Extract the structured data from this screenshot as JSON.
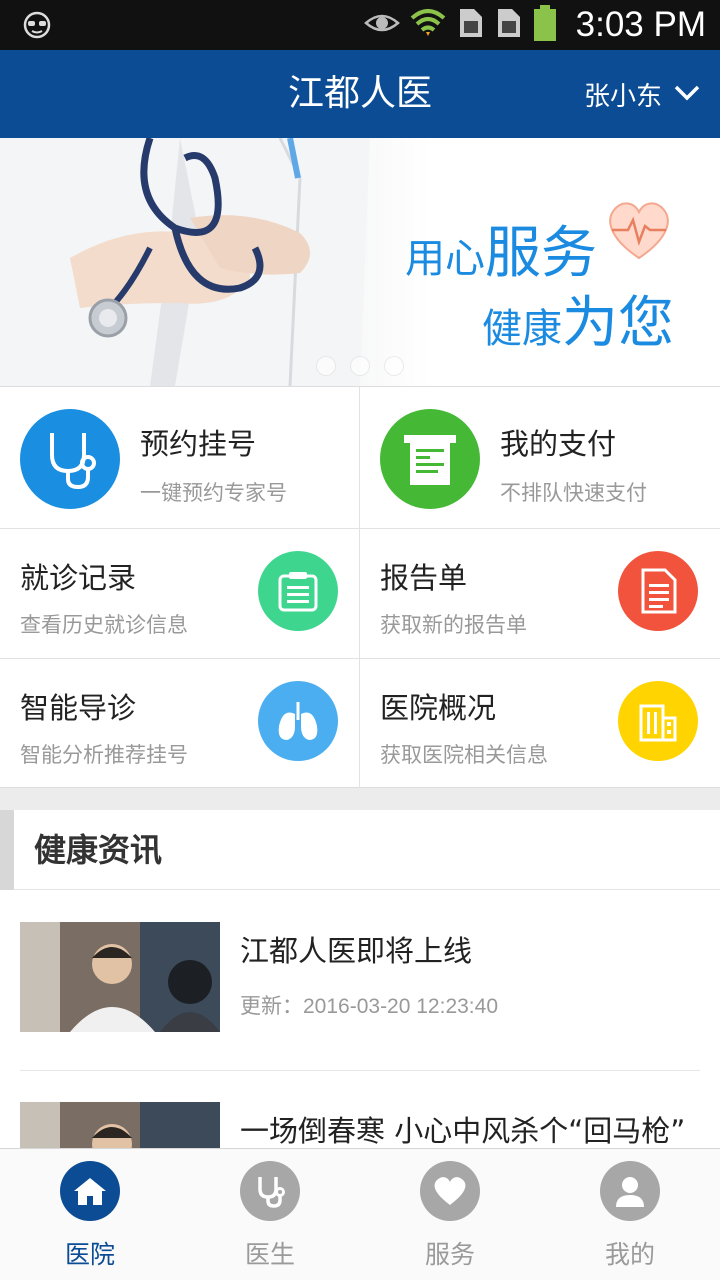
{
  "status_bar": {
    "time": "3:03 PM"
  },
  "header": {
    "title": "江都人医",
    "user_name": "张小东"
  },
  "banner": {
    "line1_small": "用心",
    "line1_big": "服务",
    "line2_small": "健康",
    "line2_big": "为您"
  },
  "features": [
    {
      "title": "预约挂号",
      "subtitle": "一键预约专家号",
      "icon": "stethoscope-icon",
      "color": "#1a8ee0"
    },
    {
      "title": "我的支付",
      "subtitle": "不排队快速支付",
      "icon": "receipt-icon",
      "color": "#45b935"
    },
    {
      "title": "就诊记录",
      "subtitle": "查看历史就诊信息",
      "icon": "record-icon",
      "color": "#3ed68e"
    },
    {
      "title": "报告单",
      "subtitle": "获取新的报告单",
      "icon": "report-icon",
      "color": "#f2533c"
    },
    {
      "title": "智能导诊",
      "subtitle": "智能分析推荐挂号",
      "icon": "lungs-icon",
      "color": "#4aaef0"
    },
    {
      "title": "医院概况",
      "subtitle": "获取医院相关信息",
      "icon": "hospital-icon",
      "color": "#ffd400"
    }
  ],
  "news": {
    "section_title": "健康资讯",
    "items": [
      {
        "title": "江都人医即将上线",
        "updated": "更新：2016-03-20 12:23:40"
      },
      {
        "title": "一场倒春寒 小心中风杀个“回马枪”"
      }
    ]
  },
  "tabs": [
    {
      "label": "医院",
      "icon": "home-icon",
      "active": true
    },
    {
      "label": "医生",
      "icon": "stethoscope-icon",
      "active": false
    },
    {
      "label": "服务",
      "icon": "heart-icon",
      "active": false
    },
    {
      "label": "我的",
      "icon": "person-icon",
      "active": false
    }
  ],
  "colors": {
    "primary": "#0b4c95",
    "banner_text": "#1a8be0"
  }
}
